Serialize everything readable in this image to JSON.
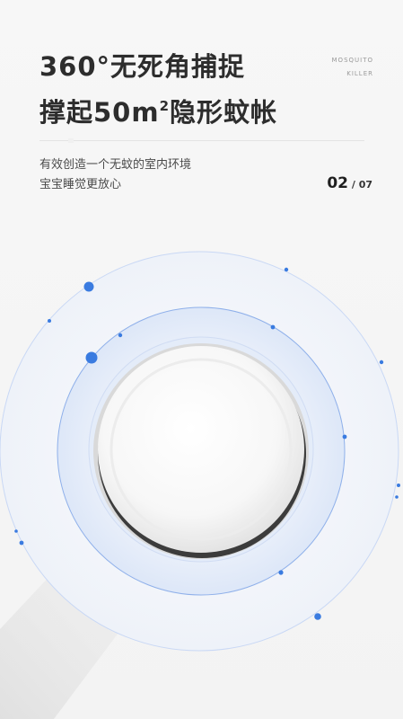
{
  "headline": {
    "line1": "360°无死角捕捉",
    "line2_prefix": "撑起50m",
    "line2_sup": "2",
    "line2_suffix": "隐形蚊帐"
  },
  "brand": {
    "line1": "MOSQUITO",
    "line2": "KILLER"
  },
  "subtitle": {
    "line1": "有效创造一个无蚊的室内环境",
    "line2": "宝宝睡觉更放心"
  },
  "pagination": {
    "current": "02",
    "separator": " / ",
    "total": "07"
  },
  "colors": {
    "accent_blue": "#3a7be0",
    "ring_fill": "#e3ecfa",
    "text_dark": "#2d2d2d"
  }
}
